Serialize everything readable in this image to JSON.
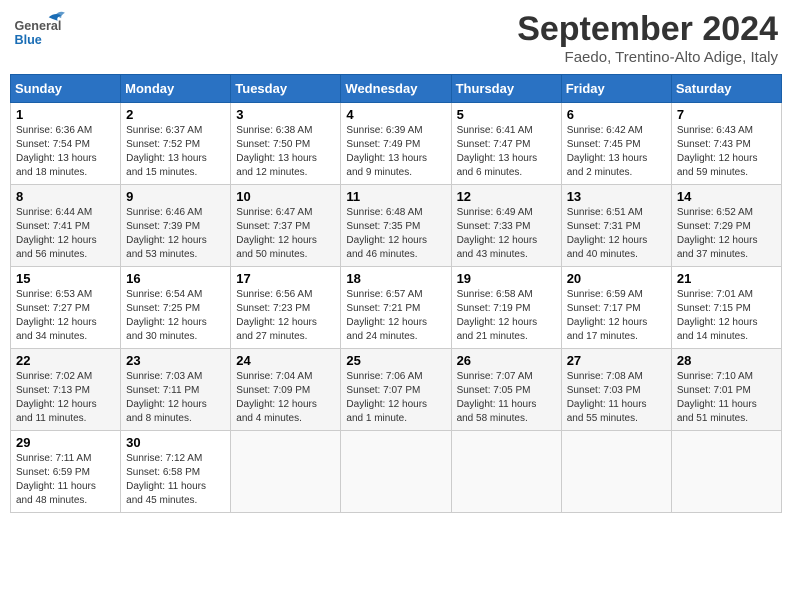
{
  "header": {
    "logo_text_general": "General",
    "logo_text_blue": "Blue",
    "month": "September 2024",
    "location": "Faedo, Trentino-Alto Adige, Italy"
  },
  "calendar": {
    "days_of_week": [
      "Sunday",
      "Monday",
      "Tuesday",
      "Wednesday",
      "Thursday",
      "Friday",
      "Saturday"
    ],
    "weeks": [
      [
        {
          "day": "1",
          "sunrise": "Sunrise: 6:36 AM",
          "sunset": "Sunset: 7:54 PM",
          "daylight": "Daylight: 13 hours and 18 minutes."
        },
        {
          "day": "2",
          "sunrise": "Sunrise: 6:37 AM",
          "sunset": "Sunset: 7:52 PM",
          "daylight": "Daylight: 13 hours and 15 minutes."
        },
        {
          "day": "3",
          "sunrise": "Sunrise: 6:38 AM",
          "sunset": "Sunset: 7:50 PM",
          "daylight": "Daylight: 13 hours and 12 minutes."
        },
        {
          "day": "4",
          "sunrise": "Sunrise: 6:39 AM",
          "sunset": "Sunset: 7:49 PM",
          "daylight": "Daylight: 13 hours and 9 minutes."
        },
        {
          "day": "5",
          "sunrise": "Sunrise: 6:41 AM",
          "sunset": "Sunset: 7:47 PM",
          "daylight": "Daylight: 13 hours and 6 minutes."
        },
        {
          "day": "6",
          "sunrise": "Sunrise: 6:42 AM",
          "sunset": "Sunset: 7:45 PM",
          "daylight": "Daylight: 13 hours and 2 minutes."
        },
        {
          "day": "7",
          "sunrise": "Sunrise: 6:43 AM",
          "sunset": "Sunset: 7:43 PM",
          "daylight": "Daylight: 12 hours and 59 minutes."
        }
      ],
      [
        {
          "day": "8",
          "sunrise": "Sunrise: 6:44 AM",
          "sunset": "Sunset: 7:41 PM",
          "daylight": "Daylight: 12 hours and 56 minutes."
        },
        {
          "day": "9",
          "sunrise": "Sunrise: 6:46 AM",
          "sunset": "Sunset: 7:39 PM",
          "daylight": "Daylight: 12 hours and 53 minutes."
        },
        {
          "day": "10",
          "sunrise": "Sunrise: 6:47 AM",
          "sunset": "Sunset: 7:37 PM",
          "daylight": "Daylight: 12 hours and 50 minutes."
        },
        {
          "day": "11",
          "sunrise": "Sunrise: 6:48 AM",
          "sunset": "Sunset: 7:35 PM",
          "daylight": "Daylight: 12 hours and 46 minutes."
        },
        {
          "day": "12",
          "sunrise": "Sunrise: 6:49 AM",
          "sunset": "Sunset: 7:33 PM",
          "daylight": "Daylight: 12 hours and 43 minutes."
        },
        {
          "day": "13",
          "sunrise": "Sunrise: 6:51 AM",
          "sunset": "Sunset: 7:31 PM",
          "daylight": "Daylight: 12 hours and 40 minutes."
        },
        {
          "day": "14",
          "sunrise": "Sunrise: 6:52 AM",
          "sunset": "Sunset: 7:29 PM",
          "daylight": "Daylight: 12 hours and 37 minutes."
        }
      ],
      [
        {
          "day": "15",
          "sunrise": "Sunrise: 6:53 AM",
          "sunset": "Sunset: 7:27 PM",
          "daylight": "Daylight: 12 hours and 34 minutes."
        },
        {
          "day": "16",
          "sunrise": "Sunrise: 6:54 AM",
          "sunset": "Sunset: 7:25 PM",
          "daylight": "Daylight: 12 hours and 30 minutes."
        },
        {
          "day": "17",
          "sunrise": "Sunrise: 6:56 AM",
          "sunset": "Sunset: 7:23 PM",
          "daylight": "Daylight: 12 hours and 27 minutes."
        },
        {
          "day": "18",
          "sunrise": "Sunrise: 6:57 AM",
          "sunset": "Sunset: 7:21 PM",
          "daylight": "Daylight: 12 hours and 24 minutes."
        },
        {
          "day": "19",
          "sunrise": "Sunrise: 6:58 AM",
          "sunset": "Sunset: 7:19 PM",
          "daylight": "Daylight: 12 hours and 21 minutes."
        },
        {
          "day": "20",
          "sunrise": "Sunrise: 6:59 AM",
          "sunset": "Sunset: 7:17 PM",
          "daylight": "Daylight: 12 hours and 17 minutes."
        },
        {
          "day": "21",
          "sunrise": "Sunrise: 7:01 AM",
          "sunset": "Sunset: 7:15 PM",
          "daylight": "Daylight: 12 hours and 14 minutes."
        }
      ],
      [
        {
          "day": "22",
          "sunrise": "Sunrise: 7:02 AM",
          "sunset": "Sunset: 7:13 PM",
          "daylight": "Daylight: 12 hours and 11 minutes."
        },
        {
          "day": "23",
          "sunrise": "Sunrise: 7:03 AM",
          "sunset": "Sunset: 7:11 PM",
          "daylight": "Daylight: 12 hours and 8 minutes."
        },
        {
          "day": "24",
          "sunrise": "Sunrise: 7:04 AM",
          "sunset": "Sunset: 7:09 PM",
          "daylight": "Daylight: 12 hours and 4 minutes."
        },
        {
          "day": "25",
          "sunrise": "Sunrise: 7:06 AM",
          "sunset": "Sunset: 7:07 PM",
          "daylight": "Daylight: 12 hours and 1 minute."
        },
        {
          "day": "26",
          "sunrise": "Sunrise: 7:07 AM",
          "sunset": "Sunset: 7:05 PM",
          "daylight": "Daylight: 11 hours and 58 minutes."
        },
        {
          "day": "27",
          "sunrise": "Sunrise: 7:08 AM",
          "sunset": "Sunset: 7:03 PM",
          "daylight": "Daylight: 11 hours and 55 minutes."
        },
        {
          "day": "28",
          "sunrise": "Sunrise: 7:10 AM",
          "sunset": "Sunset: 7:01 PM",
          "daylight": "Daylight: 11 hours and 51 minutes."
        }
      ],
      [
        {
          "day": "29",
          "sunrise": "Sunrise: 7:11 AM",
          "sunset": "Sunset: 6:59 PM",
          "daylight": "Daylight: 11 hours and 48 minutes."
        },
        {
          "day": "30",
          "sunrise": "Sunrise: 7:12 AM",
          "sunset": "Sunset: 6:58 PM",
          "daylight": "Daylight: 11 hours and 45 minutes."
        },
        {
          "day": "",
          "sunrise": "",
          "sunset": "",
          "daylight": ""
        },
        {
          "day": "",
          "sunrise": "",
          "sunset": "",
          "daylight": ""
        },
        {
          "day": "",
          "sunrise": "",
          "sunset": "",
          "daylight": ""
        },
        {
          "day": "",
          "sunrise": "",
          "sunset": "",
          "daylight": ""
        },
        {
          "day": "",
          "sunrise": "",
          "sunset": "",
          "daylight": ""
        }
      ]
    ]
  }
}
